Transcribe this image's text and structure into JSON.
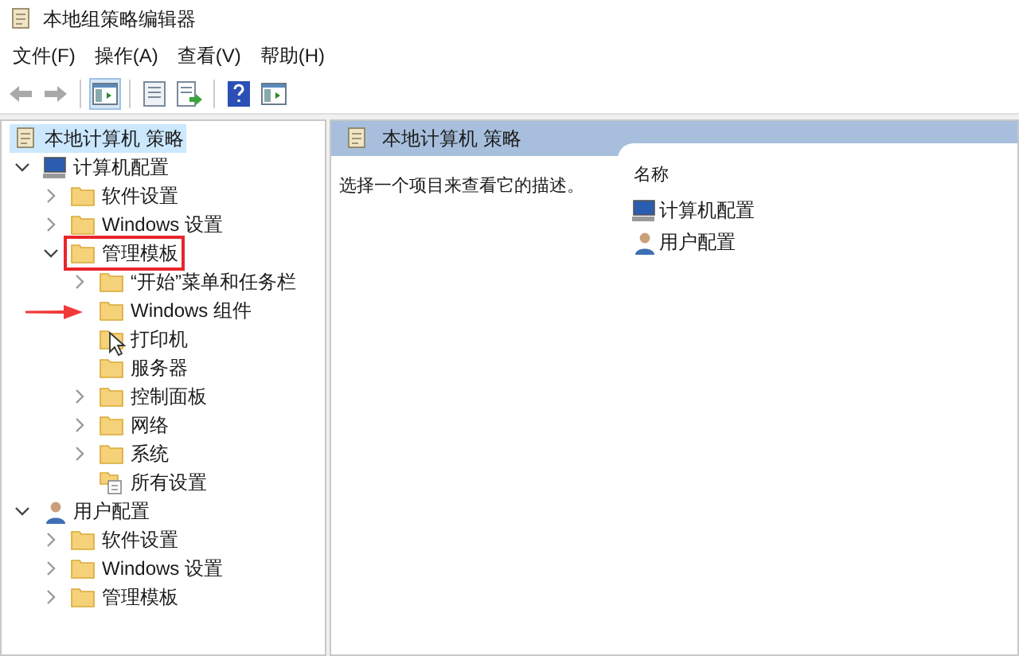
{
  "window": {
    "title": "本地组策略编辑器"
  },
  "menu": [
    {
      "label": "文件(F)"
    },
    {
      "label": "操作(A)"
    },
    {
      "label": "查看(V)"
    },
    {
      "label": "帮助(H)"
    }
  ],
  "toolbar": [
    {
      "kind": "back",
      "disabled": true
    },
    {
      "kind": "forward",
      "disabled": true
    },
    {
      "kind": "sep"
    },
    {
      "kind": "tree",
      "selected": true
    },
    {
      "kind": "sep"
    },
    {
      "kind": "props",
      "selected": false
    },
    {
      "kind": "export",
      "selected": false
    },
    {
      "kind": "sep"
    },
    {
      "kind": "help",
      "selected": false
    },
    {
      "kind": "panel",
      "selected": false
    }
  ],
  "tree": [
    {
      "label": "本地计算机 策略",
      "kind": "policy",
      "selected": true,
      "children": [
        {
          "label": "计算机配置",
          "kind": "computer",
          "expandable": true,
          "expanded": true,
          "selected": false,
          "boxed": false,
          "arrow": false,
          "cursor": false,
          "children": [
            {
              "label": "软件设置",
              "kind": "folder",
              "expandable": true,
              "expanded": false,
              "selected": false,
              "boxed": false,
              "arrow": false,
              "cursor": false
            },
            {
              "label": "Windows 设置",
              "kind": "folder",
              "expandable": true,
              "expanded": false,
              "selected": false,
              "boxed": false,
              "arrow": false,
              "cursor": false
            },
            {
              "label": "管理模板",
              "kind": "folder",
              "expandable": true,
              "expanded": true,
              "selected": false,
              "boxed": true,
              "arrow": false,
              "cursor": false,
              "children": [
                {
                  "label": "“开始”菜单和任务栏",
                  "kind": "folder",
                  "expandable": true,
                  "expanded": false,
                  "selected": false,
                  "boxed": false,
                  "arrow": false,
                  "cursor": false
                },
                {
                  "label": "Windows 组件",
                  "kind": "folder",
                  "expandable": false,
                  "expanded": false,
                  "selected": false,
                  "boxed": false,
                  "arrow": true,
                  "cursor": false
                },
                {
                  "label": "打印机",
                  "kind": "folder",
                  "expandable": false,
                  "expanded": false,
                  "selected": false,
                  "boxed": false,
                  "arrow": false,
                  "cursor": true
                },
                {
                  "label": "服务器",
                  "kind": "folder",
                  "expandable": false,
                  "expanded": false,
                  "selected": false,
                  "boxed": false,
                  "arrow": false,
                  "cursor": false
                },
                {
                  "label": "控制面板",
                  "kind": "folder",
                  "expandable": true,
                  "expanded": false,
                  "selected": false,
                  "boxed": false,
                  "arrow": false,
                  "cursor": false
                },
                {
                  "label": "网络",
                  "kind": "folder",
                  "expandable": true,
                  "expanded": false,
                  "selected": false,
                  "boxed": false,
                  "arrow": false,
                  "cursor": false
                },
                {
                  "label": "系统",
                  "kind": "folder",
                  "expandable": true,
                  "expanded": false,
                  "selected": false,
                  "boxed": false,
                  "arrow": false,
                  "cursor": false
                },
                {
                  "label": "所有设置",
                  "kind": "settings",
                  "expandable": false,
                  "expanded": false,
                  "selected": false,
                  "boxed": false,
                  "arrow": false,
                  "cursor": false
                }
              ]
            }
          ]
        },
        {
          "label": "用户配置",
          "kind": "user",
          "expandable": true,
          "expanded": true,
          "selected": false,
          "boxed": false,
          "arrow": false,
          "cursor": false,
          "children": [
            {
              "label": "软件设置",
              "kind": "folder",
              "expandable": true,
              "expanded": false,
              "selected": false,
              "boxed": false,
              "arrow": false,
              "cursor": false
            },
            {
              "label": "Windows 设置",
              "kind": "folder",
              "expandable": true,
              "expanded": false,
              "selected": false,
              "boxed": false,
              "arrow": false,
              "cursor": false
            },
            {
              "label": "管理模板",
              "kind": "folder",
              "expandable": true,
              "expanded": false,
              "selected": false,
              "boxed": false,
              "arrow": false,
              "cursor": false
            }
          ]
        }
      ]
    }
  ],
  "details": {
    "title": "本地计算机 策略",
    "description": "选择一个项目来查看它的描述。",
    "column": "名称",
    "items": [
      {
        "label": "计算机配置",
        "kind": "computer"
      },
      {
        "label": "用户配置",
        "kind": "user"
      }
    ]
  }
}
